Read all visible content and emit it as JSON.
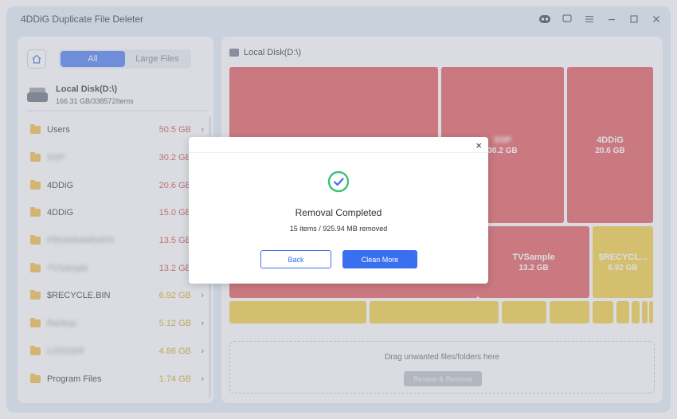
{
  "window": {
    "title": "4DDiG Duplicate File Deleter"
  },
  "titlebar": {
    "icons": [
      "assistant-icon",
      "feedback-icon",
      "menu-icon",
      "minimize-icon",
      "maximize-icon",
      "close-icon"
    ]
  },
  "left": {
    "tabs": {
      "all": "All",
      "large": "Large Files"
    },
    "disk": {
      "name": "Local Disk(D:\\)",
      "usage": "166.31 GB/338572Items"
    },
    "items": [
      {
        "name": "Users",
        "size": "50.5 GB",
        "color": "#c43d3d"
      },
      {
        "name": "SSP",
        "size": "30.2 GB",
        "color": "#c43d3d"
      },
      {
        "name": "4DDiG",
        "size": "20.6 GB",
        "color": "#c43d3d"
      },
      {
        "name": "4DDiG",
        "size": "15.0 GB",
        "color": "#c43d3d"
      },
      {
        "name": "PROGRAMDATA",
        "size": "13.5 GB",
        "color": "#c43d3d"
      },
      {
        "name": "TVSample",
        "size": "13.2 GB",
        "color": "#c43d3d"
      },
      {
        "name": "$RECYCLE.BIN",
        "size": "6.92 GB",
        "color": "#c9a000"
      },
      {
        "name": "Backup",
        "size": "5.12 GB",
        "color": "#c9a000"
      },
      {
        "name": "LOGGER",
        "size": "4.86 GB",
        "color": "#c9a000"
      },
      {
        "name": "Program Files",
        "size": "1.74 GB",
        "color": "#c9a000"
      }
    ]
  },
  "right": {
    "title": "Local Disk(D:\\)",
    "tiles": [
      {
        "label": "",
        "size": ""
      },
      {
        "label": "SSP",
        "size": "30.2 GB"
      },
      {
        "label": "4DDiG",
        "size": "20.6 GB"
      },
      {
        "label": "TVSample",
        "size": "13.2 GB"
      },
      {
        "label": "$RECYCL...",
        "size": "6.92 GB"
      }
    ],
    "drop_text": "Drag unwanted files/folders here",
    "drop_button": "Review & Remove"
  },
  "dialog": {
    "title": "Removal Completed",
    "subtitle": "15 items / 925.94 MB removed",
    "back": "Back",
    "clean_more": "Clean More",
    "close": "×",
    "accent": "#3a6ff0",
    "check_color": "#3ec17a"
  }
}
